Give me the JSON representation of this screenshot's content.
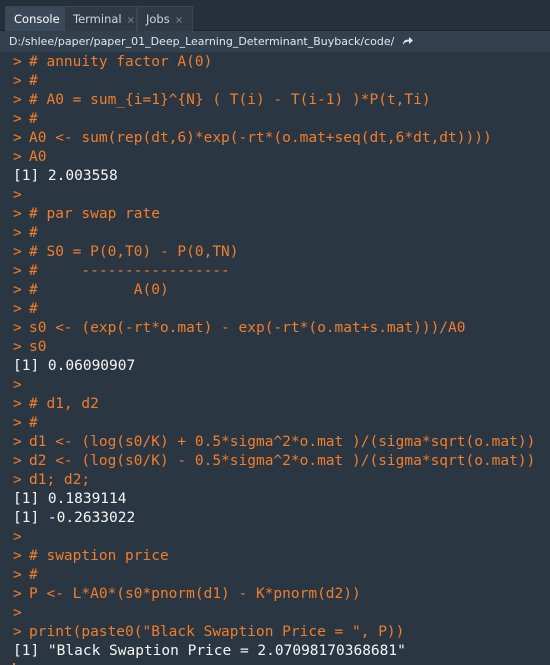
{
  "tabs": [
    {
      "label": "Console"
    },
    {
      "label": "Terminal"
    },
    {
      "label": "Jobs"
    }
  ],
  "path": "D:/shlee/paper/paper_01_Deep_Learning_Determinant_Buyback/code/",
  "prompt_symbol": ">",
  "close_glyph": "×",
  "colors": {
    "background": "#2b3643",
    "input_text": "#f07e2c",
    "output_text": "#f5f5f5"
  },
  "console_lines": [
    {
      "type": "input",
      "text": "# annuity factor A(0)"
    },
    {
      "type": "input",
      "text": "#"
    },
    {
      "type": "input",
      "text": "# A0 = sum_{i=1}^{N} ( T(i) - T(i-1) )*P(t,Ti)"
    },
    {
      "type": "input",
      "text": "#"
    },
    {
      "type": "input",
      "text": "A0 <- sum(rep(dt,6)*exp(-rt*(o.mat+seq(dt,6*dt,dt))))"
    },
    {
      "type": "input",
      "text": "A0"
    },
    {
      "type": "output",
      "text": "[1] 2.003558"
    },
    {
      "type": "input",
      "text": ""
    },
    {
      "type": "input",
      "text": "# par swap rate"
    },
    {
      "type": "input",
      "text": "#"
    },
    {
      "type": "input",
      "text": "# S0 = P(0,T0) - P(0,TN)"
    },
    {
      "type": "input",
      "text": "#     -----------------"
    },
    {
      "type": "input",
      "text": "#           A(0)"
    },
    {
      "type": "input",
      "text": "#"
    },
    {
      "type": "input",
      "text": "s0 <- (exp(-rt*o.mat) - exp(-rt*(o.mat+s.mat)))/A0"
    },
    {
      "type": "input",
      "text": "s0"
    },
    {
      "type": "output",
      "text": "[1] 0.06090907"
    },
    {
      "type": "input",
      "text": ""
    },
    {
      "type": "input",
      "text": "# d1, d2"
    },
    {
      "type": "input",
      "text": "#"
    },
    {
      "type": "input",
      "text": "d1 <- (log(s0/K) + 0.5*sigma^2*o.mat )/(sigma*sqrt(o.mat))"
    },
    {
      "type": "input",
      "text": "d2 <- (log(s0/K) - 0.5*sigma^2*o.mat )/(sigma*sqrt(o.mat))"
    },
    {
      "type": "input",
      "text": "d1; d2;"
    },
    {
      "type": "output",
      "text": "[1] 0.1839114"
    },
    {
      "type": "output",
      "text": "[1] -0.2633022"
    },
    {
      "type": "input",
      "text": ""
    },
    {
      "type": "input",
      "text": "# swaption price"
    },
    {
      "type": "input",
      "text": "#"
    },
    {
      "type": "input",
      "text": "P <- L*A0*(s0*pnorm(d1) - K*pnorm(d2))"
    },
    {
      "type": "input",
      "text": ""
    },
    {
      "type": "input",
      "text": "print(paste0(\"Black Swaption Price = \", P))"
    },
    {
      "type": "output",
      "text": "[1] \"Black Swaption Price = 2.07098170368681\""
    },
    {
      "type": "input",
      "text": ""
    }
  ]
}
